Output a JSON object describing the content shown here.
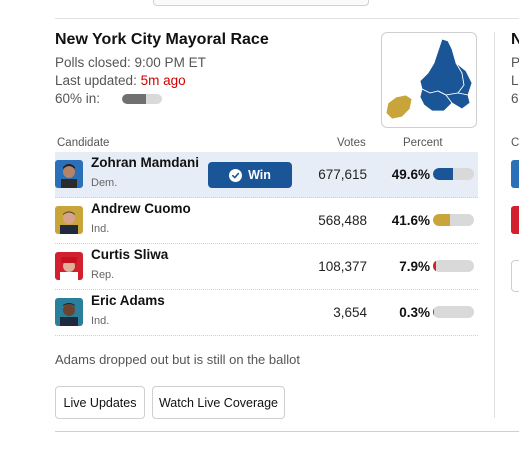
{
  "race": {
    "title": "New York City Mayoral Race",
    "polls_closed": "Polls closed: 9:00 PM ET",
    "last_updated_label": "Last updated:",
    "last_updated_value": "5m ago",
    "pct_in_label": "60% in:",
    "pct_in_value": 0.6
  },
  "table": {
    "headers": {
      "candidate": "Candidate",
      "votes": "Votes",
      "percent": "Percent"
    },
    "win_label": "Win",
    "rows": [
      {
        "name": "Zohran Mamdani",
        "party": "Dem.",
        "votes": "677,615",
        "percent": "49.6%",
        "percent_value": 49.6,
        "color": "#1a5598",
        "winner": true
      },
      {
        "name": "Andrew Cuomo",
        "party": "Ind.",
        "votes": "568,488",
        "percent": "41.6%",
        "percent_value": 41.6,
        "color": "#c9a43a",
        "winner": false
      },
      {
        "name": "Curtis Sliwa",
        "party": "Rep.",
        "votes": "108,377",
        "percent": "7.9%",
        "percent_value": 7.9,
        "color": "#d2202f",
        "winner": false
      },
      {
        "name": "Eric Adams",
        "party": "Ind.",
        "votes": "3,654",
        "percent": "0.3%",
        "percent_value": 0.3,
        "color": "#d2202f",
        "winner": false
      }
    ]
  },
  "note": "Adams dropped out but is still on the ballot",
  "buttons": {
    "live_updates": "Live Updates",
    "watch_live": "Watch Live Coverage"
  },
  "map": {
    "leading_color": "#1a5598",
    "second_color": "#c9a43a",
    "icon": "nyc-borough-map-icon"
  },
  "next_card": {
    "title_fragment": "N",
    "meta_fragments": [
      "P",
      "L",
      "6"
    ],
    "header_fragment": "C"
  }
}
